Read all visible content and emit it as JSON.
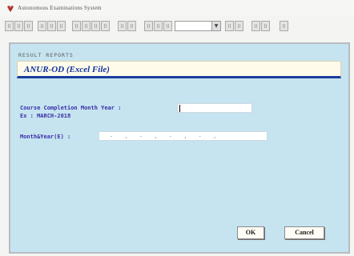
{
  "window": {
    "title": "Autonomous Examinations System",
    "icon": "app-logo-icon"
  },
  "toolbar": {
    "icons": [
      "print-icon",
      "save-icon",
      "new-icon",
      "cut-icon",
      "copy-icon",
      "paste-icon",
      "first-record-icon",
      "previous-record-icon",
      "next-record-icon",
      "last-record-icon",
      "insert-record-icon",
      "delete-record-icon",
      "query-icon",
      "execute-icon",
      "find-icon",
      "filter-icon",
      "sort-icon",
      "report-icon",
      "exit-icon",
      "help-icon"
    ],
    "combo_value": ""
  },
  "form": {
    "section_label": "RESULT REPORTS",
    "title": "ANUR-OD (Excel File)",
    "course_label": "Course Completion Month Year :",
    "course_value": "",
    "example_text": "Ex : MARCH-2018",
    "monthyear_label": "Month&Year(E) :",
    "monthyear_mask": "  -   ,   -   ,   -   ,   -   ,"
  },
  "buttons": {
    "ok": "OK",
    "cancel": "Cancel"
  },
  "colors": {
    "panel_bg": "#c5e4f0",
    "header_bg": "#fffbea",
    "header_accent": "#1a3d9e",
    "label_color": "#3a2fa8",
    "title_color": "#1233a0"
  }
}
